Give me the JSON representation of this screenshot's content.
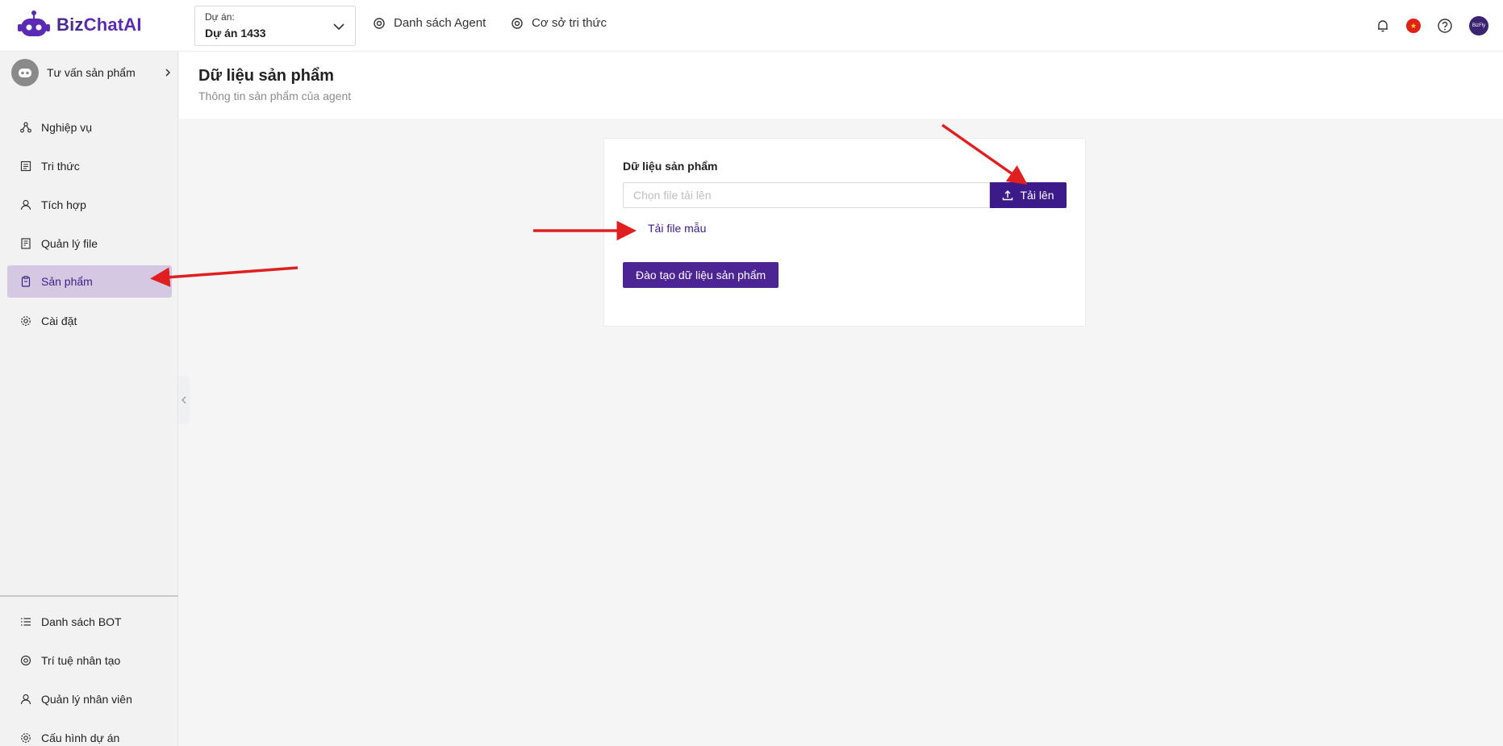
{
  "brand": {
    "name_part1": "Biz",
    "name_part2": "ChatAI"
  },
  "header": {
    "project_label": "Dự án:",
    "project_value": "Dự án 1433",
    "nav": [
      {
        "label": "Danh sách Agent",
        "icon": "openai-icon"
      },
      {
        "label": "Cơ sở tri thức",
        "icon": "openai-icon"
      }
    ],
    "icons": [
      "bell-icon",
      "vietnam-flag-icon",
      "help-icon",
      "user-avatar"
    ],
    "avatar_text": "BizFly"
  },
  "sidebar": {
    "agent_name": "Tư vấn sản phẩm",
    "items": [
      {
        "label": "Nghiệp vụ",
        "icon": "workflow-icon"
      },
      {
        "label": "Tri thức",
        "icon": "document-icon"
      },
      {
        "label": "Tích hợp",
        "icon": "user-icon"
      },
      {
        "label": "Quản lý file",
        "icon": "file-list-icon"
      },
      {
        "label": "Sản phẩm",
        "icon": "product-icon",
        "active": true
      },
      {
        "label": "Cài đặt",
        "icon": "gear-icon"
      }
    ],
    "bottom_items": [
      {
        "label": "Danh sách BOT",
        "icon": "list-icon"
      },
      {
        "label": "Trí tuệ nhân tạo",
        "icon": "openai-icon"
      },
      {
        "label": "Quản lý nhân viên",
        "icon": "user-icon"
      },
      {
        "label": "Cấu hình dự án",
        "icon": "gear-icon"
      }
    ]
  },
  "page": {
    "title": "Dữ liệu sản phẩm",
    "subtitle": "Thông tin sản phẩm của agent"
  },
  "card": {
    "title": "Dữ liệu sản phẩm",
    "file_placeholder": "Chọn file tải lên",
    "upload_label": "Tải lên",
    "sample_link": "Tải file mẫu",
    "train_label": "Đào tạo dữ liệu sản phẩm"
  },
  "colors": {
    "brand": "#4a2c8f",
    "primary_button": "#3d1a8a",
    "active_nav_bg": "#d4c8e2",
    "annotation_arrow": "#e02020"
  }
}
